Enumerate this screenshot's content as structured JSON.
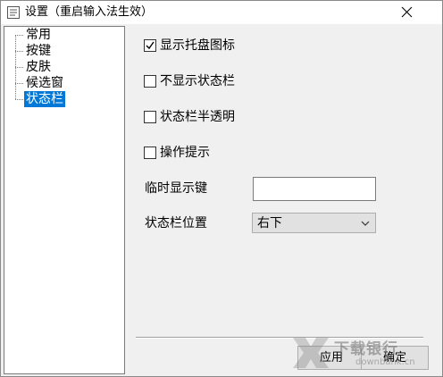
{
  "window": {
    "title": "设置（重启输入法生效）"
  },
  "tree": {
    "items": [
      {
        "label": "常用",
        "selected": false
      },
      {
        "label": "按键",
        "selected": false
      },
      {
        "label": "皮肤",
        "selected": false
      },
      {
        "label": "候选窗",
        "selected": false
      },
      {
        "label": "状态栏",
        "selected": true
      }
    ]
  },
  "options": [
    {
      "label": "显示托盘图标",
      "checked": true
    },
    {
      "label": "不显示状态栏",
      "checked": false
    },
    {
      "label": "状态栏半透明",
      "checked": false
    },
    {
      "label": "操作提示",
      "checked": false
    }
  ],
  "hotkey": {
    "label": "临时显示键",
    "value": ""
  },
  "position": {
    "label": "状态栏位置",
    "selected": "右下"
  },
  "buttons": {
    "apply": "应用",
    "ok": "确定"
  },
  "watermark": {
    "text": "下载银行",
    "url": "downbank.cn"
  },
  "colors": {
    "selection": "#0078d7",
    "background": "#f0f0f0"
  }
}
